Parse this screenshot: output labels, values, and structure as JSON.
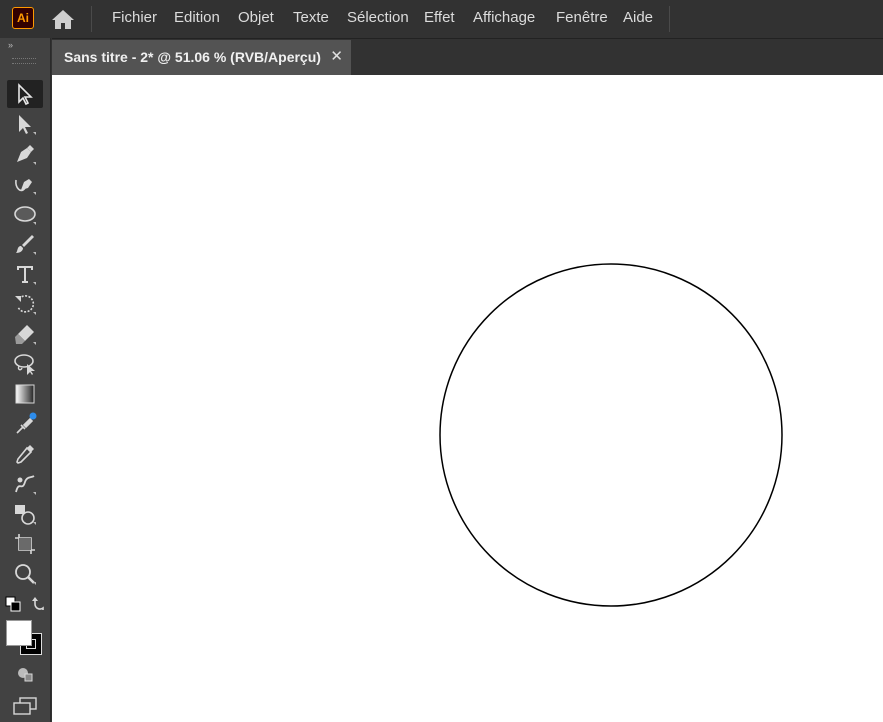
{
  "app": {
    "logo_text": "Ai",
    "accent": "#ff9a00"
  },
  "menu": [
    "Fichier",
    "Edition",
    "Objet",
    "Texte",
    "Sélection",
    "Effet",
    "Affichage",
    "Fenêtre",
    "Aide"
  ],
  "document": {
    "tab_title": "Sans titre - 2* @ 51.06 % (RVB/Aperçu)",
    "close_glyph": "✕"
  },
  "toolbar": {
    "collapse_glyph": "»",
    "tools": [
      "selection-tool",
      "direct-selection-tool",
      "pen-tool",
      "curvature-tool",
      "ellipse-tool",
      "paintbrush-tool",
      "type-tool",
      "rotate-tool",
      "eraser-tool",
      "lasso-tool",
      "gradient-tool",
      "puppet-warp-tool",
      "eyedropper-tool",
      "blend-tool",
      "shape-builder-tool",
      "artboard-tool",
      "zoom-tool"
    ],
    "active_tool": "selection-tool",
    "fill_color": "#ffffff",
    "stroke_color": "#000000"
  },
  "canvas": {
    "background": "#ffffff",
    "shapes": [
      {
        "type": "circle",
        "stroke": "#000000",
        "fill": "none"
      }
    ]
  }
}
